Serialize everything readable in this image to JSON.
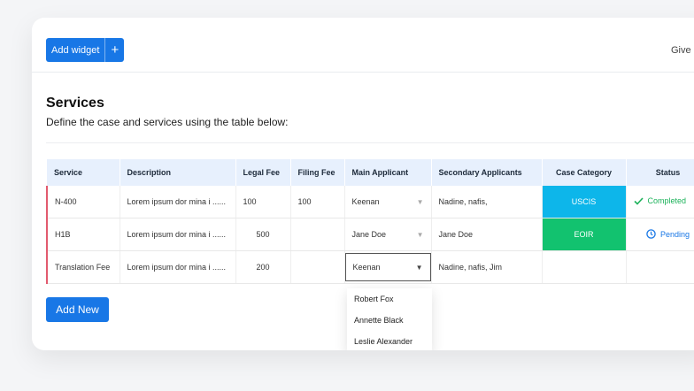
{
  "toolbar": {
    "add_widget_label": "Add widget",
    "add_widget_plus": "+",
    "give_text": "Give I"
  },
  "section": {
    "title": "Services",
    "subtitle": "Define the case and services using the table below:"
  },
  "table": {
    "headers": [
      "Service",
      "Description",
      "Legal Fee",
      "Filing Fee",
      "Main Applicant",
      "Secondary Applicants",
      "Case Category",
      "Status"
    ],
    "rows": [
      {
        "service": "N-400",
        "description": "Lorem ipsum dor mina i ......",
        "legal_fee": "100",
        "filing_fee": "100",
        "main_applicant": "Keenan",
        "secondary": "Nadine, nafis,",
        "category": "USCIS",
        "status": "Completed"
      },
      {
        "service": "H1B",
        "description": "Lorem ipsum dor mina i ......",
        "legal_fee": "500",
        "filing_fee": "",
        "main_applicant": "Jane Doe",
        "secondary": "Jane Doe",
        "category": "EOIR",
        "status": "Pending"
      },
      {
        "service": "Translation Fee",
        "description": "Lorem ipsum dor mina i ......",
        "legal_fee": "200",
        "filing_fee": "",
        "main_applicant": "Keenan",
        "secondary": "Nadine, nafis, Jim",
        "category": "",
        "status": ""
      }
    ]
  },
  "add_new_label": "Add New",
  "dropdown": {
    "options": [
      "Robert Fox",
      "Annette Black",
      "Leslie Alexander"
    ]
  },
  "colors": {
    "accent": "#1877e6",
    "uscis": "#0db6ea",
    "eoir": "#12c26f",
    "completed": "#1cb25a",
    "row_marker": "#e25a6e"
  }
}
